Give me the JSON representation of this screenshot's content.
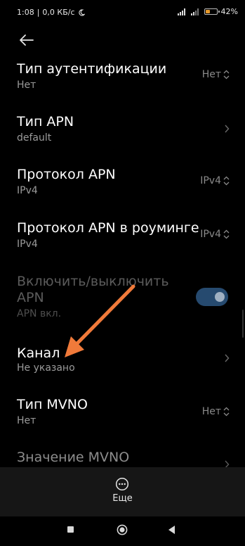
{
  "status_bar": {
    "time": "1:08",
    "speed": "0,0 КБ/с",
    "battery": "42",
    "battery_level": 0.42
  },
  "rows": [
    {
      "title": "Тип аутентификации",
      "subtitle": "Нет",
      "value": "Нет"
    },
    {
      "title": "Тип APN",
      "subtitle": "default"
    },
    {
      "title": "Протокол APN",
      "subtitle": "IPv4",
      "value": "IPv4"
    },
    {
      "title": "Протокол APN в роуминге",
      "subtitle": "IPv4",
      "value": "IPv4"
    },
    {
      "title_line1": "Включить/выключить",
      "title_line2": "APN",
      "subtitle": "APN вкл.",
      "toggle_on": true
    },
    {
      "title": "Канал",
      "subtitle": "Не указано"
    },
    {
      "title": "Тип MVNO",
      "subtitle": "Нет",
      "value": "Нет"
    },
    {
      "title": "Значение MVNO"
    }
  ],
  "bottom": {
    "more_label": "Еще"
  },
  "annotation": {
    "color": "#f07a3a"
  }
}
